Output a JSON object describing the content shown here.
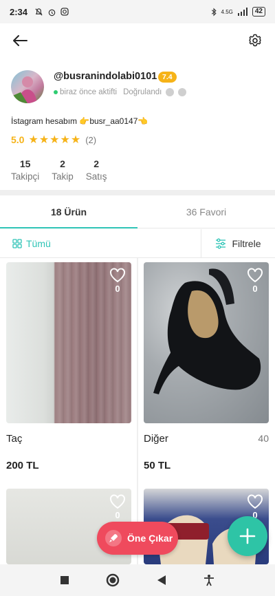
{
  "status_bar": {
    "time": "2:34",
    "battery": "42",
    "network": "4.5G"
  },
  "profile": {
    "username": "@busranindolabi0101",
    "rating_badge": "7.4",
    "active_status": "biraz önce aktifti",
    "verified_label": "Doğrulandı",
    "bio": "İstagram hesabım 👉busr_aa0147👈",
    "score": "5.0",
    "stars": "★★★★★",
    "review_count": "(2)",
    "stats": [
      {
        "value": "15",
        "label": "Takipçi"
      },
      {
        "value": "2",
        "label": "Takip"
      },
      {
        "value": "2",
        "label": "Satış"
      }
    ]
  },
  "tabs": [
    {
      "label": "18 Ürün",
      "active": true
    },
    {
      "label": "36 Favori",
      "active": false
    }
  ],
  "filters": {
    "all_label": "Tümü",
    "filter_label": "Filtrele"
  },
  "products": [
    {
      "title": "Taç",
      "size": "",
      "price": "200 TL",
      "likes": "0"
    },
    {
      "title": "Diğer",
      "size": "40",
      "price": "50 TL",
      "likes": "0"
    },
    {
      "title": "",
      "size": "",
      "price": "",
      "likes": "0"
    },
    {
      "title": "",
      "size": "",
      "price": "",
      "likes": "0"
    }
  ],
  "actions": {
    "promote_label": "Öne Çıkar"
  },
  "colors": {
    "accent": "#2ec4b6",
    "promote": "#ef4a5d",
    "star": "#f6b318"
  }
}
